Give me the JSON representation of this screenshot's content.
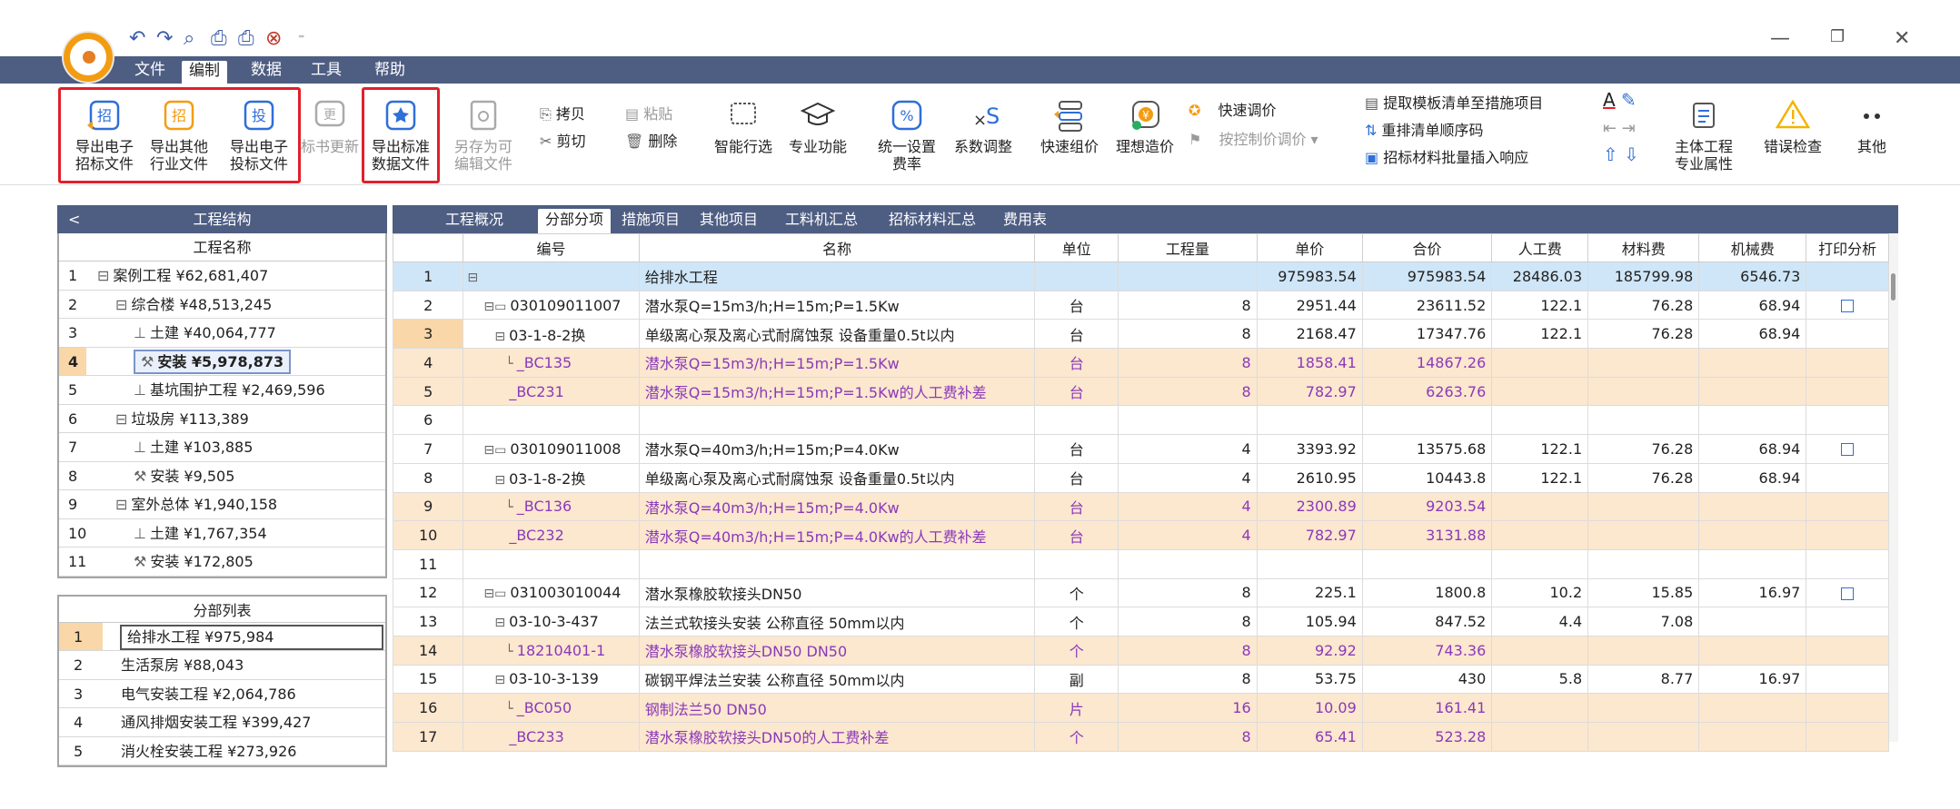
{
  "window": {
    "controls": [
      "—",
      "❐",
      "✕"
    ],
    "quick_access": [
      "↶",
      "↷",
      "⌕",
      "⎙",
      "⎙",
      "⊗",
      "⁼"
    ]
  },
  "menu": {
    "items": [
      "文件",
      "编制",
      "数据",
      "工具",
      "帮助"
    ],
    "active": "编制"
  },
  "ribbon": {
    "export_bid_file": "导出电子\n招标文件",
    "export_other": "导出其他\n行业文件",
    "export_tender": "导出电子\n投标文件",
    "bid_update": "标书更新",
    "export_standard": "导出标准\n数据文件",
    "save_as": "另存为可\n编辑文件",
    "copy": "拷贝",
    "paste": "粘贴",
    "cut": "剪切",
    "delete": "删除",
    "smart_select": "智能行选",
    "specialty": "专业功能",
    "unified_rate": "统一设置\n费率",
    "coef_adjust": "系数调整",
    "quick_price": "快速组价",
    "ideal_cost": "理想造价",
    "quick_adjust": "快速调价",
    "control_adjust": "按控制价调价",
    "extract_template": "提取模板清单至措施项目",
    "renumber": "重排清单顺序码",
    "batch_insert": "招标材料批量插入响应",
    "main_project": "主体工程\n专业属性",
    "error_check": "错误检查",
    "more": "其他"
  },
  "left_panel": {
    "title": "工程结构",
    "back": "<",
    "column": "工程名称",
    "tree": [
      {
        "n": "1",
        "glyph": "⊟",
        "text": "案例工程 ¥62,681,407",
        "indent": 0
      },
      {
        "n": "2",
        "glyph": "⊟",
        "text": "综合楼 ¥48,513,245",
        "indent": 1
      },
      {
        "n": "3",
        "glyph": "⊥",
        "text": "土建 ¥40,064,777",
        "indent": 2
      },
      {
        "n": "4",
        "glyph": "⚒",
        "text": "安装 ¥5,978,873",
        "indent": 2,
        "selected": true
      },
      {
        "n": "5",
        "glyph": "⊥",
        "text": "基坑围护工程 ¥2,469,596",
        "indent": 2
      },
      {
        "n": "6",
        "glyph": "⊟",
        "text": "垃圾房 ¥113,389",
        "indent": 1
      },
      {
        "n": "7",
        "glyph": "⊥",
        "text": "土建 ¥103,885",
        "indent": 2
      },
      {
        "n": "8",
        "glyph": "⚒",
        "text": "安装 ¥9,505",
        "indent": 2
      },
      {
        "n": "9",
        "glyph": "⊟",
        "text": "室外总体 ¥1,940,158",
        "indent": 1
      },
      {
        "n": "10",
        "glyph": "⊥",
        "text": "土建 ¥1,767,354",
        "indent": 2
      },
      {
        "n": "11",
        "glyph": "⚒",
        "text": "安装 ¥172,805",
        "indent": 2
      }
    ],
    "sub_title": "分部列表",
    "divisions": [
      {
        "n": "1",
        "text": "给排水工程 ¥975,984",
        "selected": true
      },
      {
        "n": "2",
        "text": "生活泵房 ¥88,043"
      },
      {
        "n": "3",
        "text": "电气安装工程 ¥2,064,786"
      },
      {
        "n": "4",
        "text": "通风排烟安装工程 ¥399,427"
      },
      {
        "n": "5",
        "text": "消火栓安装工程 ¥273,926"
      }
    ]
  },
  "main": {
    "tabs": [
      "工程概况",
      "分部分项",
      "措施项目",
      "其他项目",
      "工料机汇总",
      "招标材料汇总",
      "费用表"
    ],
    "active_tab": "分部分项",
    "columns": [
      "",
      "编号",
      "名称",
      "单位",
      "工程量",
      "单价",
      "合价",
      "人工费",
      "材料费",
      "机械费",
      "打印分析"
    ],
    "rows": [
      {
        "idx": "1",
        "type": "section",
        "tree": "⊟",
        "code": "",
        "name": "给排水工程",
        "unit": "",
        "qty": "",
        "price": "975983.54",
        "total": "975983.54",
        "labor": "28486.03",
        "material": "185799.98",
        "machine": "6546.73",
        "chk": false
      },
      {
        "idx": "2",
        "type": "list",
        "tree": "⊟▭",
        "code": "030109011007",
        "name": "潜水泵Q=15m3/h;H=15m;P=1.5Kw",
        "unit": "台",
        "qty": "8",
        "price": "2951.44",
        "total": "23611.52",
        "labor": "122.1",
        "material": "76.28",
        "machine": "68.94",
        "chk": true
      },
      {
        "idx": "3",
        "type": "quota",
        "tree": "⊟",
        "code": "03-1-8-2换",
        "name": "单级离心泵及离心式耐腐蚀泵 设备重量0.5t以内",
        "unit": "台",
        "qty": "8",
        "price": "2168.47",
        "total": "17347.76",
        "labor": "122.1",
        "material": "76.28",
        "machine": "68.94",
        "chk": false,
        "selected": true
      },
      {
        "idx": "4",
        "type": "sub",
        "tree": "└",
        "code": "_BC135",
        "name": "潜水泵Q=15m3/h;H=15m;P=1.5Kw",
        "unit": "台",
        "qty": "8",
        "price": "1858.41",
        "total": "14867.26",
        "labor": "",
        "material": "",
        "machine": "",
        "chk": false
      },
      {
        "idx": "5",
        "type": "sub",
        "tree": "",
        "code": "_BC231",
        "name": "潜水泵Q=15m3/h;H=15m;P=1.5Kw的人工费补差",
        "unit": "台",
        "qty": "8",
        "price": "782.97",
        "total": "6263.76",
        "labor": "",
        "material": "",
        "machine": "",
        "chk": false
      },
      {
        "idx": "6",
        "type": "empty",
        "tree": "",
        "code": "",
        "name": "",
        "unit": "",
        "qty": "",
        "price": "",
        "total": "",
        "labor": "",
        "material": "",
        "machine": "",
        "chk": false
      },
      {
        "idx": "7",
        "type": "list",
        "tree": "⊟▭",
        "code": "030109011008",
        "name": "潜水泵Q=40m3/h;H=15m;P=4.0Kw",
        "unit": "台",
        "qty": "4",
        "price": "3393.92",
        "total": "13575.68",
        "labor": "122.1",
        "material": "76.28",
        "machine": "68.94",
        "chk": true
      },
      {
        "idx": "8",
        "type": "quota",
        "tree": "⊟",
        "code": "03-1-8-2换",
        "name": "单级离心泵及离心式耐腐蚀泵 设备重量0.5t以内",
        "unit": "台",
        "qty": "4",
        "price": "2610.95",
        "total": "10443.8",
        "labor": "122.1",
        "material": "76.28",
        "machine": "68.94",
        "chk": false
      },
      {
        "idx": "9",
        "type": "sub",
        "tree": "└",
        "code": "_BC136",
        "name": "潜水泵Q=40m3/h;H=15m;P=4.0Kw",
        "unit": "台",
        "qty": "4",
        "price": "2300.89",
        "total": "9203.54",
        "labor": "",
        "material": "",
        "machine": "",
        "chk": false
      },
      {
        "idx": "10",
        "type": "sub",
        "tree": "",
        "code": "_BC232",
        "name": "潜水泵Q=40m3/h;H=15m;P=4.0Kw的人工费补差",
        "unit": "台",
        "qty": "4",
        "price": "782.97",
        "total": "3131.88",
        "labor": "",
        "material": "",
        "machine": "",
        "chk": false
      },
      {
        "idx": "11",
        "type": "empty",
        "tree": "",
        "code": "",
        "name": "",
        "unit": "",
        "qty": "",
        "price": "",
        "total": "",
        "labor": "",
        "material": "",
        "machine": "",
        "chk": false
      },
      {
        "idx": "12",
        "type": "list",
        "tree": "⊟▭",
        "code": "031003010044",
        "name": "潜水泵橡胶软接头DN50",
        "unit": "个",
        "qty": "8",
        "price": "225.1",
        "total": "1800.8",
        "labor": "10.2",
        "material": "15.85",
        "machine": "16.97",
        "chk": true
      },
      {
        "idx": "13",
        "type": "quota",
        "tree": "⊟",
        "code": "03-10-3-437",
        "name": "法兰式软接头安装 公称直径 50mm以内",
        "unit": "个",
        "qty": "8",
        "price": "105.94",
        "total": "847.52",
        "labor": "4.4",
        "material": "7.08",
        "machine": "",
        "chk": false
      },
      {
        "idx": "14",
        "type": "sub",
        "tree": "└",
        "code": "18210401-1",
        "name": "潜水泵橡胶软接头DN50 DN50",
        "unit": "个",
        "qty": "8",
        "price": "92.92",
        "total": "743.36",
        "labor": "",
        "material": "",
        "machine": "",
        "chk": false
      },
      {
        "idx": "15",
        "type": "quota",
        "tree": "⊟",
        "code": "03-10-3-139",
        "name": "碳钢平焊法兰安装 公称直径 50mm以内",
        "unit": "副",
        "qty": "8",
        "price": "53.75",
        "total": "430",
        "labor": "5.8",
        "material": "8.77",
        "machine": "16.97",
        "chk": false
      },
      {
        "idx": "16",
        "type": "sub",
        "tree": "└",
        "code": "_BC050",
        "name": "钢制法兰50 DN50",
        "unit": "片",
        "qty": "16",
        "price": "10.09",
        "total": "161.41",
        "labor": "",
        "material": "",
        "machine": "",
        "chk": false
      },
      {
        "idx": "17",
        "type": "sub",
        "tree": "",
        "code": "_BC233",
        "name": "潜水泵橡胶软接头DN50的人工费补差",
        "unit": "个",
        "qty": "8",
        "price": "65.41",
        "total": "523.28",
        "labor": "",
        "material": "",
        "machine": "",
        "chk": false
      }
    ]
  },
  "colors": {
    "menubar": "#4e5d82",
    "highlight_box": "#e0202a",
    "section_row": "#cfe6f8",
    "sub_row": "#fce7cf",
    "sub_text": "#8a3ab9",
    "selected_index": "#f9d7a8"
  }
}
